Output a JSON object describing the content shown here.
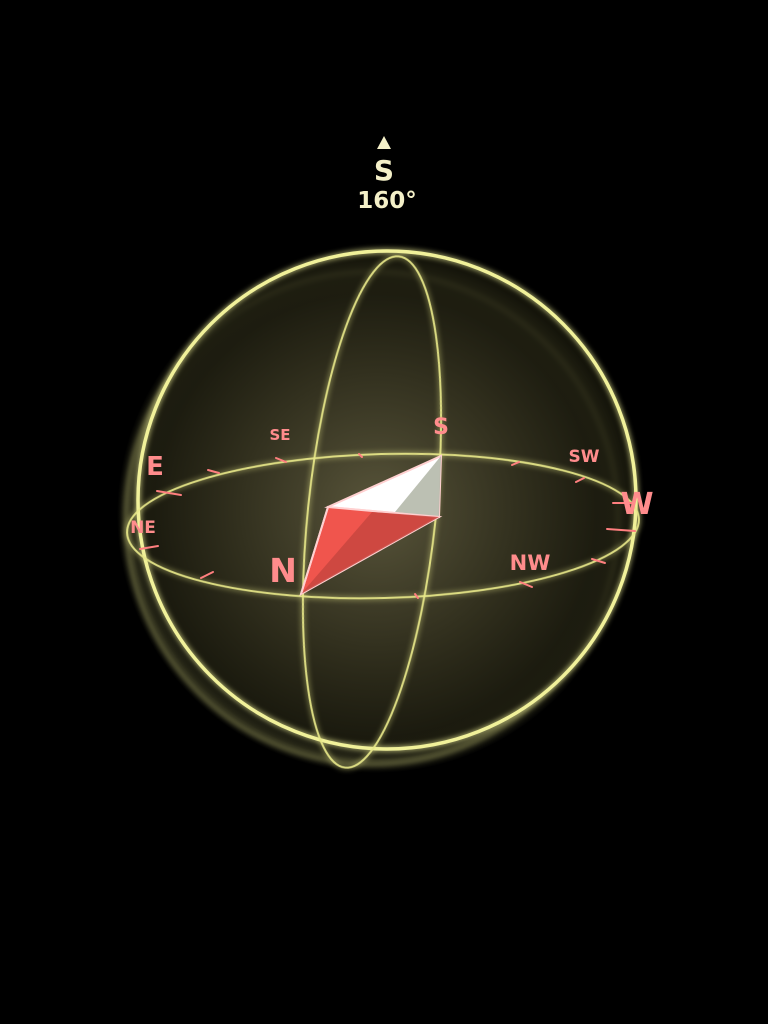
{
  "heading": {
    "indicator_icon": "triangle-up-icon",
    "direction": "S",
    "degrees": "160°"
  },
  "compass": {
    "labels": {
      "n": "N",
      "s": "S",
      "e": "E",
      "w": "W",
      "ne": "NE",
      "se": "SE",
      "sw": "SW",
      "nw": "NW"
    },
    "colors": {
      "sphere_line": "#e9e98a",
      "label": "#ff8c8c",
      "needle_north": "#f0554d",
      "needle_south": "#ffffff",
      "background": "#000000"
    }
  }
}
